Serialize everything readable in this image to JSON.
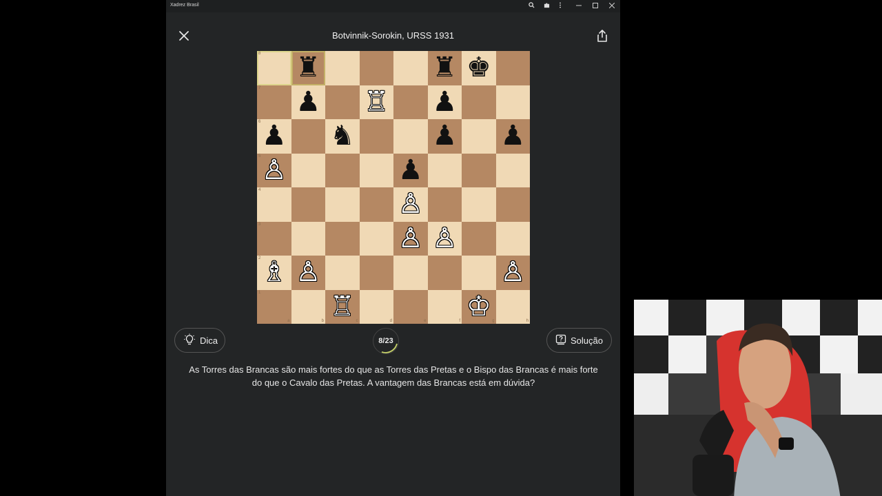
{
  "window": {
    "app_title": "Xadrez Brasil",
    "zoom_icon": "magnifier-icon",
    "extensions_icon": "puzzle-icon",
    "more_icon": "kebab-menu-icon",
    "minimize_icon": "minimize-icon",
    "maximize_icon": "maximize-icon",
    "close_icon": "close-icon"
  },
  "header": {
    "title": "Botvinnik-Sorokin, URSS 1931",
    "close_icon": "close-icon",
    "share_icon": "share-icon"
  },
  "board": {
    "files": [
      "a",
      "b",
      "c",
      "d",
      "e",
      "f",
      "g",
      "h"
    ],
    "ranks": [
      "8",
      "7",
      "6",
      "5",
      "4",
      "3",
      "2",
      "1"
    ],
    "light_color": "#f0d9b5",
    "dark_color": "#b58863",
    "highlighted_squares": [
      "a8",
      "b8"
    ],
    "pieces": [
      {
        "square": "b8",
        "piece": "rook",
        "color": "black"
      },
      {
        "square": "f8",
        "piece": "rook",
        "color": "black"
      },
      {
        "square": "g8",
        "piece": "king",
        "color": "black"
      },
      {
        "square": "b7",
        "piece": "pawn",
        "color": "black"
      },
      {
        "square": "d7",
        "piece": "rook",
        "color": "white"
      },
      {
        "square": "f7",
        "piece": "pawn",
        "color": "black"
      },
      {
        "square": "a6",
        "piece": "pawn",
        "color": "black"
      },
      {
        "square": "c6",
        "piece": "knight",
        "color": "black"
      },
      {
        "square": "f6",
        "piece": "pawn",
        "color": "black"
      },
      {
        "square": "h6",
        "piece": "pawn",
        "color": "black"
      },
      {
        "square": "a5",
        "piece": "pawn",
        "color": "white"
      },
      {
        "square": "e5",
        "piece": "pawn",
        "color": "black"
      },
      {
        "square": "e4",
        "piece": "pawn",
        "color": "white"
      },
      {
        "square": "e3",
        "piece": "pawn",
        "color": "white"
      },
      {
        "square": "f3",
        "piece": "pawn",
        "color": "white"
      },
      {
        "square": "a2",
        "piece": "bishop",
        "color": "white"
      },
      {
        "square": "b2",
        "piece": "pawn",
        "color": "white"
      },
      {
        "square": "h2",
        "piece": "pawn",
        "color": "white"
      },
      {
        "square": "c1",
        "piece": "rook",
        "color": "white"
      },
      {
        "square": "g1",
        "piece": "king",
        "color": "white"
      }
    ]
  },
  "controls": {
    "hint_label": "Dica",
    "hint_icon": "lightbulb-icon",
    "counter": "8/23",
    "solution_label": "Solução",
    "solution_icon": "question-box-icon"
  },
  "description": "As Torres das Brancas são mais fortes do que as Torres das Pretas e o Bispo das Brancas é mais forte do que o Cavalo das Pretas. A vantagem das Brancas está em dúvida?",
  "colors": {
    "app_background": "#232526",
    "accent_ring": "#c8d46a"
  }
}
